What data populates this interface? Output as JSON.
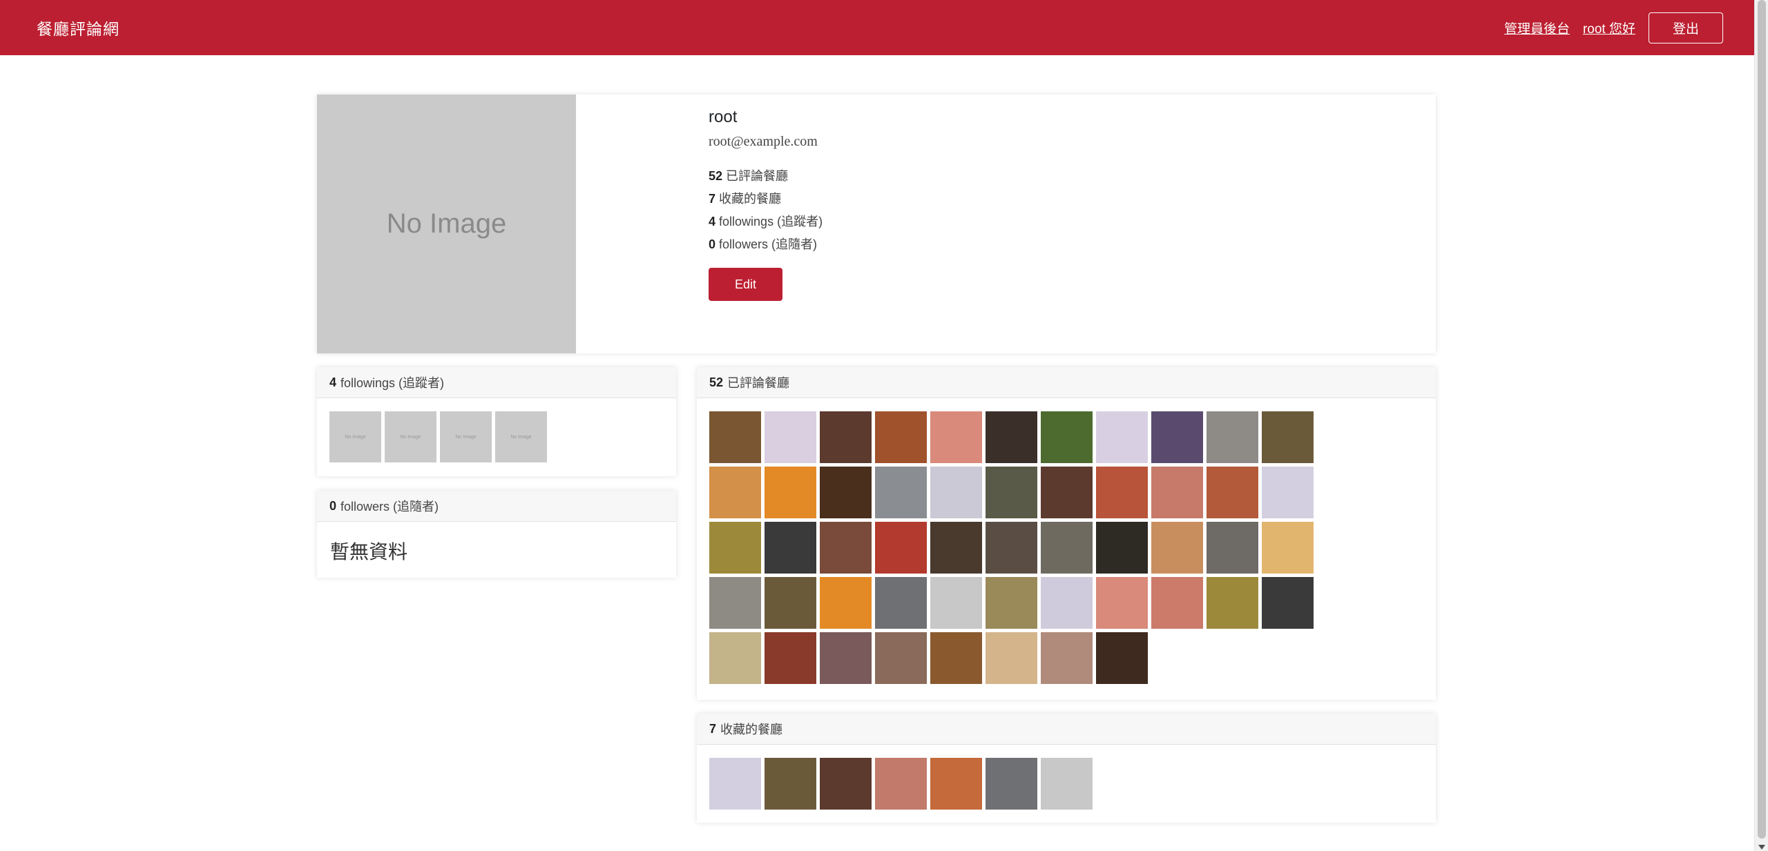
{
  "navbar": {
    "brand": "餐廳評論網",
    "admin_link": "管理員後台",
    "greeting": "root 您好",
    "logout_label": "登出",
    "color": "#bc1f31"
  },
  "profile": {
    "avatar_text": "No Image",
    "name": "root",
    "email": "root@example.com",
    "stats": [
      {
        "count": "52",
        "label": "已評論餐廳"
      },
      {
        "count": "7",
        "label": "收藏的餐廳"
      },
      {
        "count": "4",
        "label": "followings (追蹤者)"
      },
      {
        "count": "0",
        "label": "followers (追隨者)"
      }
    ],
    "edit_label": "Edit"
  },
  "followings": {
    "count": "4",
    "title": "followings (追蹤者)",
    "items": [
      "No Image",
      "No Image",
      "No Image",
      "No Image"
    ]
  },
  "followers": {
    "count": "0",
    "title": "followers (追隨者)",
    "empty": "暫無資料"
  },
  "commented": {
    "count": "52",
    "title": "已評論餐廳",
    "thumbs": [
      "#7a5632",
      "#d9cfe0",
      "#5c3a2e",
      "#a0522d",
      "#d98a7a",
      "#3b2f2a",
      "#4d6b2f",
      "#d8d0e2",
      "#5a4b6e",
      "#8e8a86",
      "#6b5a3a",
      "#d39048",
      "#e38a26",
      "#4a2f1c",
      "#8a8d92",
      "#cbc9d6",
      "#5a5a48",
      "#5c3a2e",
      "#b8543a",
      "#c87a6a",
      "#b35a3a",
      "#d4cfe0",
      "#9c8a3a",
      "#3a3a3a",
      "#7a4a3a",
      "#b33a2e",
      "#4a3a2e",
      "#5a4e44",
      "#6e6a60",
      "#2e2a24",
      "#c98e5e",
      "#6e6a66",
      "#e2b56e",
      "#8e8a84",
      "#6b5a3a",
      "#e38a26",
      "#6e7074",
      "#c8c8c8",
      "#9a8a5a",
      "#d0cbdc",
      "#d98a7a",
      "#cc7a6a",
      "#9c8a3a",
      "#3a3a3a",
      "#c4b48a",
      "#8a3a2a",
      "#7a5a5a",
      "#8a6a5a",
      "#8a5a2e",
      "#d4b48a",
      "#b08a7a",
      "#3e2a1e"
    ]
  },
  "favorites": {
    "count": "7",
    "title": "收藏的餐廳",
    "thumbs": [
      "#d4cfe0",
      "#6b5a3a",
      "#5c3a2e",
      "#c27a6a",
      "#c56a3a",
      "#6e7074",
      "#c8c8c8"
    ]
  }
}
